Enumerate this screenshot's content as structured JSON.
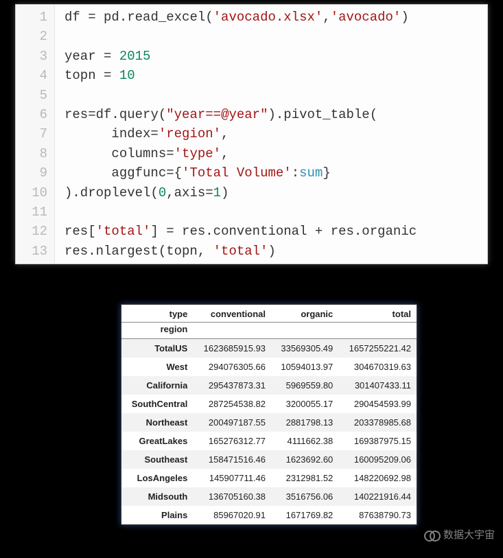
{
  "code": {
    "lines": [
      {
        "n": "1",
        "tokens": [
          [
            "",
            "df "
          ],
          [
            "op",
            "="
          ],
          [
            "",
            " pd.read_excel("
          ],
          [
            "red",
            "'avocado.xlsx'"
          ],
          [
            "op",
            ","
          ],
          [
            "red",
            "'avocado'"
          ],
          [
            "",
            ")"
          ]
        ]
      },
      {
        "n": "2",
        "tokens": [
          [
            "",
            ""
          ]
        ]
      },
      {
        "n": "3",
        "tokens": [
          [
            "",
            "year "
          ],
          [
            "op",
            "="
          ],
          [
            "",
            " "
          ],
          [
            "num",
            "2015"
          ]
        ]
      },
      {
        "n": "4",
        "tokens": [
          [
            "",
            "topn "
          ],
          [
            "op",
            "="
          ],
          [
            "",
            " "
          ],
          [
            "num",
            "10"
          ]
        ]
      },
      {
        "n": "5",
        "tokens": [
          [
            "",
            ""
          ]
        ]
      },
      {
        "n": "6",
        "tokens": [
          [
            "",
            "res"
          ],
          [
            "op",
            "="
          ],
          [
            "",
            "df.query("
          ],
          [
            "red",
            "\"year==@year\""
          ],
          [
            "",
            ").pivot_table("
          ]
        ]
      },
      {
        "n": "7",
        "tokens": [
          [
            "",
            "      index"
          ],
          [
            "op",
            "="
          ],
          [
            "red",
            "'region'"
          ],
          [
            "op",
            ","
          ]
        ]
      },
      {
        "n": "8",
        "tokens": [
          [
            "",
            "      columns"
          ],
          [
            "op",
            "="
          ],
          [
            "red",
            "'type'"
          ],
          [
            "op",
            ","
          ]
        ]
      },
      {
        "n": "9",
        "tokens": [
          [
            "",
            "      aggfunc"
          ],
          [
            "op",
            "="
          ],
          [
            "",
            "{"
          ],
          [
            "red",
            "'Total Volume'"
          ],
          [
            "op",
            ":"
          ],
          [
            "teal",
            "sum"
          ],
          [
            "",
            "}"
          ]
        ]
      },
      {
        "n": "10",
        "tokens": [
          [
            "",
            ").droplevel("
          ],
          [
            "num",
            "0"
          ],
          [
            "op",
            ","
          ],
          [
            "",
            "axis"
          ],
          [
            "op",
            "="
          ],
          [
            "num",
            "1"
          ],
          [
            "",
            ")"
          ]
        ]
      },
      {
        "n": "11",
        "tokens": [
          [
            "",
            ""
          ]
        ]
      },
      {
        "n": "12",
        "tokens": [
          [
            "",
            "res["
          ],
          [
            "red",
            "'total'"
          ],
          [
            "",
            "] "
          ],
          [
            "op",
            "="
          ],
          [
            "",
            " res.conventional "
          ],
          [
            "op",
            "+"
          ],
          [
            "",
            " res.organic"
          ]
        ]
      },
      {
        "n": "13",
        "tokens": [
          [
            "",
            "res.nlargest(topn, "
          ],
          [
            "red",
            "'total'"
          ],
          [
            "",
            ")"
          ]
        ]
      }
    ]
  },
  "table": {
    "columns_name": "type",
    "index_name": "region",
    "columns": [
      "conventional",
      "organic",
      "total"
    ],
    "rows": [
      {
        "region": "TotalUS",
        "conventional": "1623685915.93",
        "organic": "33569305.49",
        "total": "1657255221.42"
      },
      {
        "region": "West",
        "conventional": "294076305.66",
        "organic": "10594013.97",
        "total": "304670319.63"
      },
      {
        "region": "California",
        "conventional": "295437873.31",
        "organic": "5969559.80",
        "total": "301407433.11"
      },
      {
        "region": "SouthCentral",
        "conventional": "287254538.82",
        "organic": "3200055.17",
        "total": "290454593.99"
      },
      {
        "region": "Northeast",
        "conventional": "200497187.55",
        "organic": "2881798.13",
        "total": "203378985.68"
      },
      {
        "region": "GreatLakes",
        "conventional": "165276312.77",
        "organic": "4111662.38",
        "total": "169387975.15"
      },
      {
        "region": "Southeast",
        "conventional": "158471516.46",
        "organic": "1623692.60",
        "total": "160095209.06"
      },
      {
        "region": "LosAngeles",
        "conventional": "145907711.46",
        "organic": "2312981.52",
        "total": "148220692.98"
      },
      {
        "region": "Midsouth",
        "conventional": "136705160.38",
        "organic": "3516756.06",
        "total": "140221916.44"
      },
      {
        "region": "Plains",
        "conventional": "85967020.91",
        "organic": "1671769.82",
        "total": "87638790.73"
      }
    ]
  },
  "watermark": {
    "text": "数据大宇宙"
  },
  "chart_data": {
    "type": "table",
    "title": "",
    "columns": [
      "region",
      "conventional",
      "organic",
      "total"
    ],
    "rows": [
      [
        "TotalUS",
        1623685915.93,
        33569305.49,
        1657255221.42
      ],
      [
        "West",
        294076305.66,
        10594013.97,
        304670319.63
      ],
      [
        "California",
        295437873.31,
        5969559.8,
        301407433.11
      ],
      [
        "SouthCentral",
        287254538.82,
        3200055.17,
        290454593.99
      ],
      [
        "Northeast",
        200497187.55,
        2881798.13,
        203378985.68
      ],
      [
        "GreatLakes",
        165276312.77,
        4111662.38,
        169387975.15
      ],
      [
        "Southeast",
        158471516.46,
        1623692.6,
        160095209.06
      ],
      [
        "LosAngeles",
        145907711.46,
        2312981.52,
        148220692.98
      ],
      [
        "Midsouth",
        136705160.38,
        3516756.06,
        140221916.44
      ],
      [
        "Plains",
        85967020.91,
        1671769.82,
        87638790.73
      ]
    ]
  }
}
